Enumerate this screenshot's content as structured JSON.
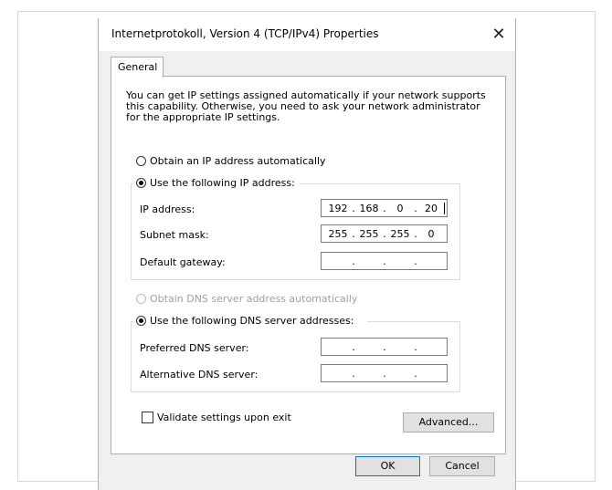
{
  "window": {
    "title": "Internetprotokoll, Version 4 (TCP/IPv4) Properties",
    "close_glyph": "✕"
  },
  "tabs": [
    {
      "label": "General",
      "selected": true
    }
  ],
  "description": "You can get IP settings assigned automatically if your network supports this capability. Otherwise, you need to ask your network administrator for the appropriate IP settings.",
  "ip_mode": {
    "auto_label": "Obtain an IP address automatically",
    "manual_label": "Use the following IP address:",
    "selected": "manual"
  },
  "ip_fields": {
    "ip_address": {
      "label": "IP address:",
      "octets": [
        "192",
        "168",
        "0",
        "20"
      ]
    },
    "subnet_mask": {
      "label": "Subnet mask:",
      "octets": [
        "255",
        "255",
        "255",
        "0"
      ]
    },
    "default_gateway": {
      "label": "Default gateway:",
      "octets": [
        "",
        "",
        "",
        ""
      ]
    }
  },
  "dns_mode": {
    "auto_label": "Obtain DNS server address automatically",
    "manual_label": "Use the following DNS server addresses:",
    "selected": "manual",
    "auto_enabled": false
  },
  "dns_fields": {
    "preferred": {
      "label": "Preferred DNS server:",
      "octets": [
        "",
        "",
        "",
        ""
      ]
    },
    "alternative": {
      "label": "Alternative DNS server:",
      "octets": [
        "",
        "",
        "",
        ""
      ]
    }
  },
  "validate": {
    "label": "Validate settings upon exit",
    "checked": false
  },
  "buttons": {
    "advanced": "Advanced...",
    "ok": "OK",
    "cancel": "Cancel"
  },
  "octet_separator": "."
}
